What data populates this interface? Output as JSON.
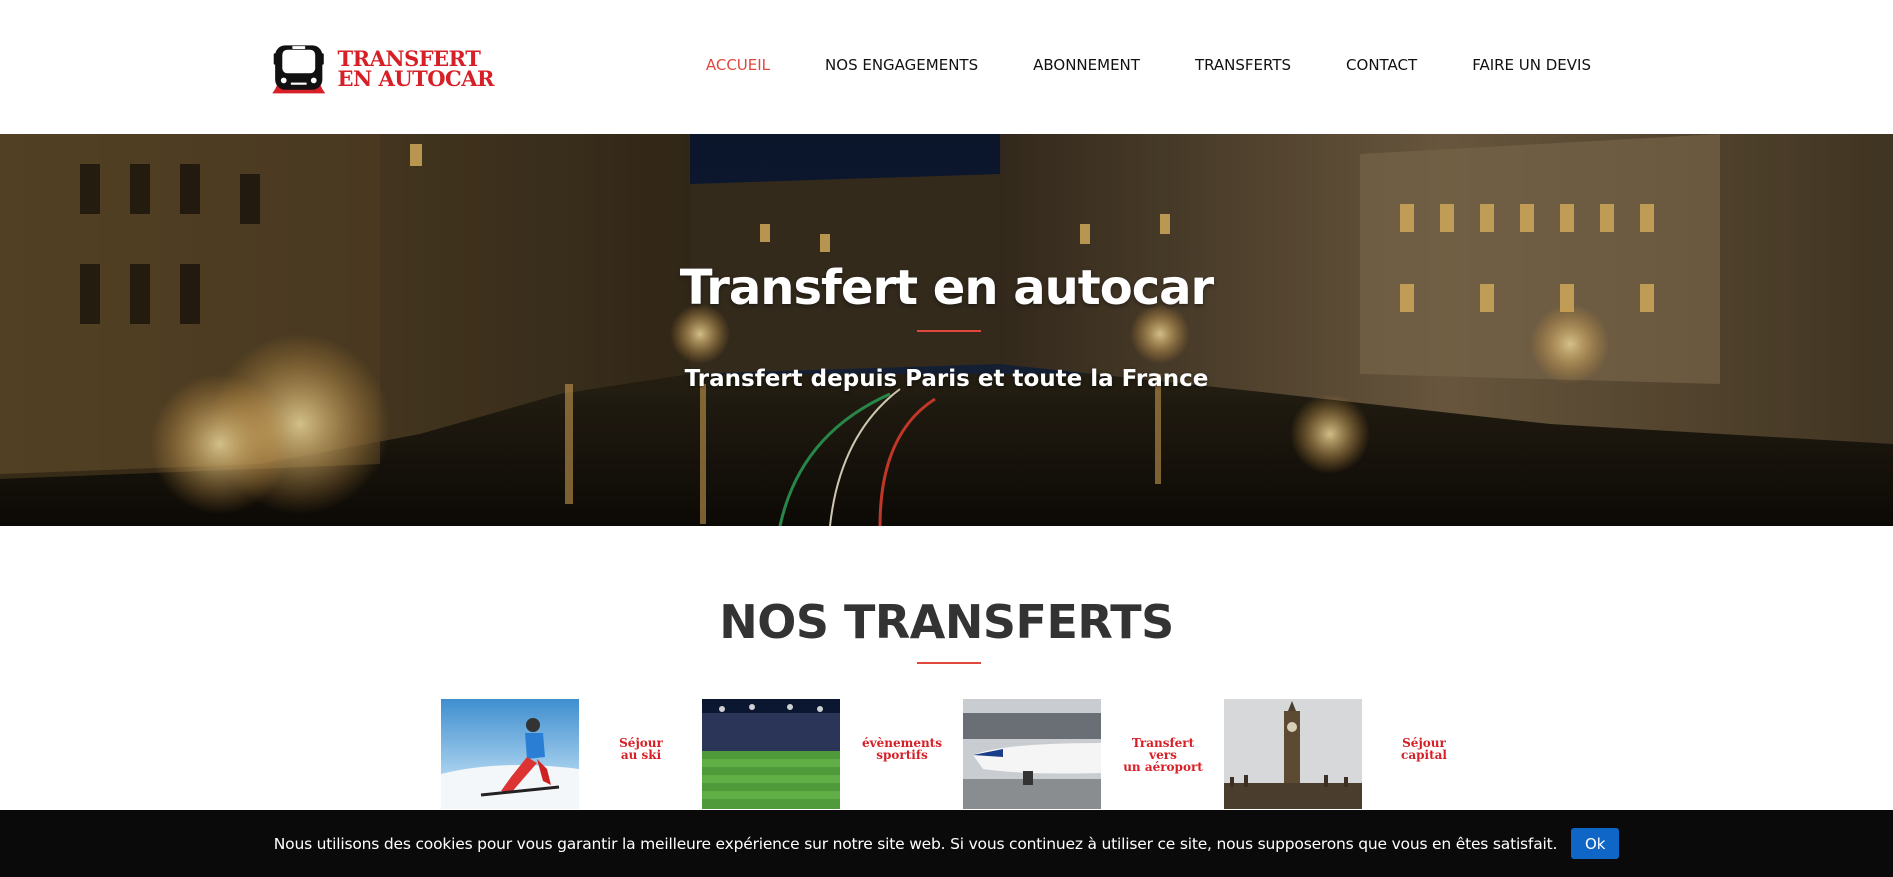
{
  "header": {
    "logo": {
      "line1": "TRANSFERT",
      "line2": "EN AUTOCAR"
    },
    "nav": [
      {
        "label": "ACCUEIL",
        "active": true
      },
      {
        "label": "NOS ENGAGEMENTS",
        "active": false
      },
      {
        "label": "ABONNEMENT",
        "active": false
      },
      {
        "label": "TRANSFERTS",
        "active": false
      },
      {
        "label": "CONTACT",
        "active": false
      },
      {
        "label": "FAIRE UN DEVIS",
        "active": false
      }
    ]
  },
  "hero": {
    "title": "Transfert en autocar",
    "subtitle": "Transfert depuis Paris et toute la France"
  },
  "section": {
    "title": "NOS TRANSFERTS",
    "cards": [
      {
        "label": "Séjour\nau ski",
        "image": "skier-photo"
      },
      {
        "label": "évènements\nsportifs",
        "image": "stadium-photo"
      },
      {
        "label": "Transfert\nvers\nun aéroport",
        "image": "airplane-photo"
      },
      {
        "label": "Séjour\ncapital",
        "image": "big-ben-photo"
      }
    ]
  },
  "cookie": {
    "text": "Nous utilisons des cookies pour vous garantir la meilleure expérience sur notre site web. Si vous continuez à utiliser ce site, nous supposerons que vous en êtes satisfait.",
    "button": "Ok"
  },
  "colors": {
    "accent": "#e0483e",
    "brand_red": "#d61f26",
    "cookie_bg": "#0a0a0a",
    "cookie_button": "#0f66c7"
  }
}
